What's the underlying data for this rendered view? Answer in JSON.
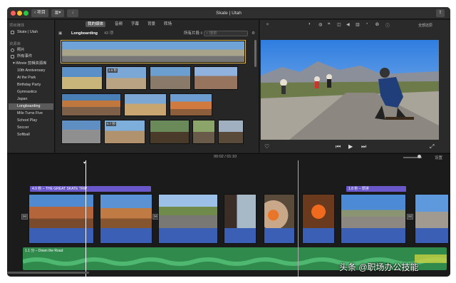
{
  "window": {
    "title": "Skate | Utah",
    "back_label": "项目"
  },
  "sidebar": {
    "section_project": "项目媒体",
    "project_item": "Skate | Utah",
    "section_library": "资源库",
    "lib_items": [
      "照片",
      "所有事件"
    ],
    "library_name": "iMovie 剪辑资源库",
    "events": [
      "10th Anniversary",
      "At the Park",
      "Birthday Party",
      "Gymnastics",
      "Japan",
      "Longboarding",
      "Milo Turns Five",
      "School Play",
      "Soccer",
      "Softball"
    ],
    "selected": "Longboarding"
  },
  "browser": {
    "tabs": [
      "我的媒体",
      "音频",
      "字幕",
      "背景",
      "转场"
    ],
    "selected_tab": "我的媒体",
    "event_name": "Longboarding",
    "item_count": "43 项",
    "filter_label": "所有片段 ◊",
    "search_placeholder": "搜索",
    "durations": [
      "3.9 秒",
      "6.7 秒"
    ]
  },
  "viewer": {
    "settings_label": "全部还原",
    "controls": [
      "♡",
      "⏮",
      "▶",
      "⏭",
      "⤢"
    ]
  },
  "timeline_header": {
    "time": "00:02 / 01:10",
    "settings_label": "设置"
  },
  "timeline": {
    "title_clip_1": "4.0 秒 – THE GREAT SKATE TRIP",
    "title_clip_2": "1.8 秒 – 厚拼",
    "music_label": "1.1 分 – Down the Road"
  },
  "watermark": "头条 @职场办公技能",
  "colors": {
    "accent": "#e0b84a",
    "title_purple": "#6a57c9",
    "music_green": "#2f8a4c",
    "audio_blue": "#3b5fb5"
  }
}
